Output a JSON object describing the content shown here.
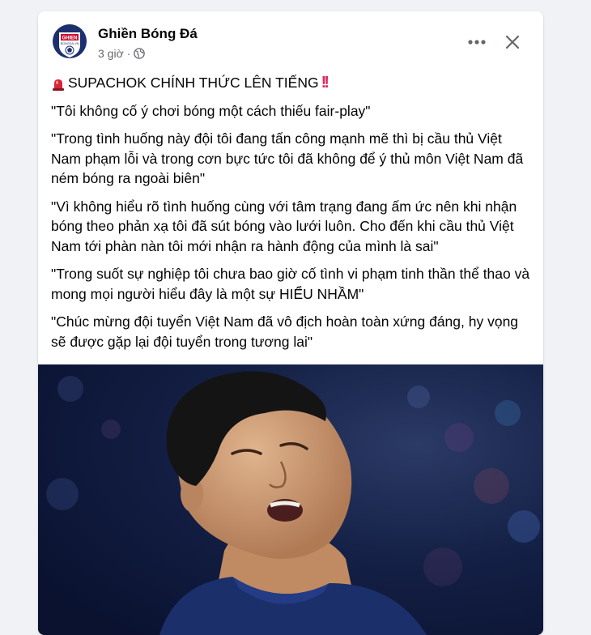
{
  "post": {
    "author": "Ghiền Bóng Đá",
    "time": "3 giờ ·",
    "avatar_text": "GHIEN BONGDA.VN",
    "headline": "SUPACHOK CHÍNH THỨC LÊN TIẾNG",
    "paragraphs": [
      "\"Tôi không cố ý chơi bóng một cách thiếu fair-play\"",
      "\"Trong tình huống này đội tôi đang tấn công mạnh mẽ thì bị cầu thủ Việt Nam phạm lỗi và trong cơn bực tức tôi đã không để ý thủ môn Việt Nam đã ném bóng ra ngoài biên\"",
      "\"Vì không hiểu rõ tình huống cùng với tâm trạng đang ấm ức nên khi nhận bóng theo phản xạ tôi đã sút bóng vào lưới luôn. Cho đến khi cầu thủ Việt Nam tới phàn nàn tôi mới nhận ra hành động của mình là sai\"",
      "\"Trong suốt sự nghiệp tôi chưa bao giờ cố tình vi phạm tinh thần thể thao và mong mọi người hiểu đây là một sự HIỂU NHẦM\"",
      "\"Chúc mừng đội tuyển Việt Nam đã vô địch hoàn toàn xứng đáng, hy vọng sẽ được gặp lại đội tuyển trong tương lai\""
    ]
  },
  "icons": {
    "globe": "globe-icon",
    "more": "more-options-icon",
    "close": "close-icon",
    "siren": "siren-icon",
    "exclamation": "double-exclamation-icon"
  },
  "colors": {
    "background": "#f0f2f5",
    "card": "#ffffff",
    "secondary_text": "#65676b",
    "exclamation": "#e0245e",
    "jersey": "#1b2f6b"
  }
}
